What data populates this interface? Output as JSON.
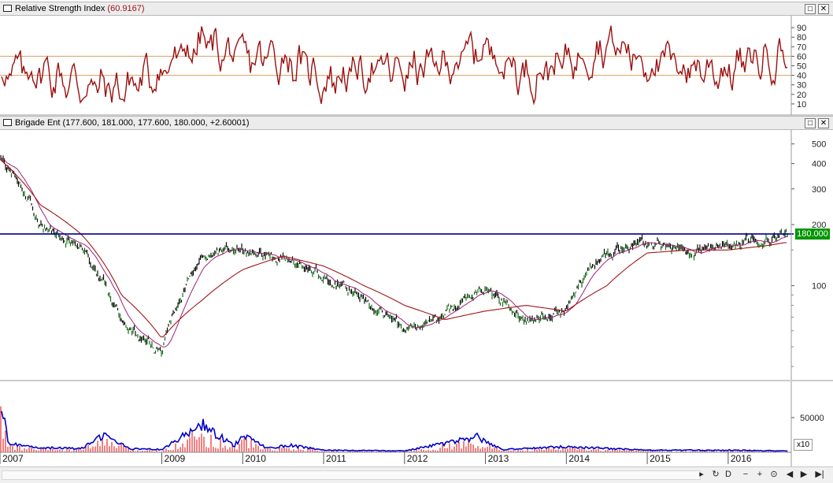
{
  "rsi_pane": {
    "title": "Relative Strength Index",
    "value": "(60.9167)",
    "restore_glyph": "□",
    "close_glyph": "✕"
  },
  "price_pane": {
    "title": "Brigade Ent",
    "quote": "(177.600, 181.000, 177.600, 180.000, +2.60001)",
    "restore_glyph": "□",
    "close_glyph": "✕",
    "last_price_label": "180.000"
  },
  "volume_pane": {
    "multiplier_label": "x10"
  },
  "nav": {
    "buttons": [
      {
        "icon": "refresh-icon",
        "glyph": "↻"
      },
      {
        "icon": "d-icon",
        "glyph": "D"
      },
      {
        "icon": "zoom-out-icon",
        "glyph": "−"
      },
      {
        "icon": "zoom-in-icon",
        "glyph": "+"
      },
      {
        "icon": "target-icon",
        "glyph": "⊙"
      },
      {
        "icon": "prev-icon",
        "glyph": "◀"
      },
      {
        "icon": "next-icon",
        "glyph": "▶"
      },
      {
        "icon": "last-icon",
        "glyph": "▶|"
      }
    ]
  },
  "colors": {
    "rsi_line": "#9b1010",
    "rsi_levels": "#d8a060",
    "candle_up": "#1a6b1a",
    "candle_down": "#0a0a0a",
    "ma_long": "#a01818",
    "ma_short": "#a0207a",
    "resistance_line": "#00008b",
    "volume_line": "#0000c8",
    "volume_bars": "#e00000",
    "price_label_bg": "#009600"
  },
  "chart_data": [
    {
      "type": "line",
      "title": "Relative Strength Index",
      "current_value": 60.9167,
      "ylim": [
        0,
        100
      ],
      "y_ticks": [
        10,
        20,
        30,
        40,
        50,
        60,
        70,
        80,
        90
      ],
      "reference_levels": [
        40,
        60
      ],
      "x": [
        2007.0,
        2007.5,
        2008.0,
        2008.5,
        2009.0,
        2009.5,
        2010.0,
        2010.5,
        2011.0,
        2011.5,
        2012.0,
        2012.5,
        2013.0,
        2013.5,
        2014.0,
        2014.5,
        2015.0,
        2015.5,
        2016.0,
        2016.5
      ],
      "series": [
        {
          "values": [
            40,
            45,
            30,
            25,
            45,
            75,
            55,
            60,
            35,
            45,
            45,
            50,
            70,
            40,
            55,
            75,
            55,
            50,
            45,
            61
          ]
        }
      ]
    },
    {
      "type": "line",
      "title": "Brigade Ent",
      "scale": "log",
      "ylim": [
        35,
        570
      ],
      "y_ticks": [
        100,
        200,
        300,
        400,
        500
      ],
      "last_close": 180.0,
      "resistance_level": 180.0,
      "x": [
        2007.0,
        2007.5,
        2008.0,
        2008.5,
        2009.0,
        2009.25,
        2009.5,
        2010.0,
        2010.5,
        2011.0,
        2011.5,
        2012.0,
        2012.5,
        2013.0,
        2013.5,
        2014.0,
        2014.5,
        2015.0,
        2015.5,
        2016.0,
        2016.5,
        2016.7
      ],
      "series": [
        {
          "values": [
            420,
            200,
            150,
            65,
            45,
            90,
            140,
            150,
            135,
            110,
            85,
            60,
            72,
            100,
            65,
            80,
            145,
            160,
            150,
            155,
            170,
            180
          ]
        },
        {
          "values": [
            420,
            250,
            180,
            90,
            55,
            70,
            85,
            120,
            140,
            125,
            100,
            80,
            68,
            75,
            80,
            75,
            100,
            145,
            150,
            150,
            158,
            163
          ]
        }
      ]
    },
    {
      "type": "area",
      "title": "Volume",
      "y_ticks": [
        50000
      ],
      "x": [
        2007.0,
        2007.1,
        2007.3,
        2008.0,
        2008.3,
        2008.6,
        2009.0,
        2009.5,
        2009.6,
        2009.9,
        2010.0,
        2010.3,
        2010.6,
        2011.0,
        2012.0,
        2012.75,
        2012.9,
        2013.2,
        2014.0,
        2015.0,
        2016.0,
        2016.7
      ],
      "series": [
        {
          "values": [
            80000,
            15000,
            8000,
            5000,
            25000,
            5000,
            4000,
            40000,
            30000,
            10000,
            25000,
            6000,
            10000,
            3000,
            2000,
            18000,
            22000,
            4000,
            8000,
            3000,
            3000,
            2000
          ]
        }
      ]
    }
  ],
  "x_axis": {
    "labels": [
      "2007",
      "2009",
      "2010",
      "2011",
      "2012",
      "2013",
      "2014",
      "2015",
      "2016"
    ],
    "years": [
      2007.0,
      2009.0,
      2010.0,
      2011.0,
      2012.0,
      2013.0,
      2014.0,
      2015.0,
      2016.0
    ]
  }
}
